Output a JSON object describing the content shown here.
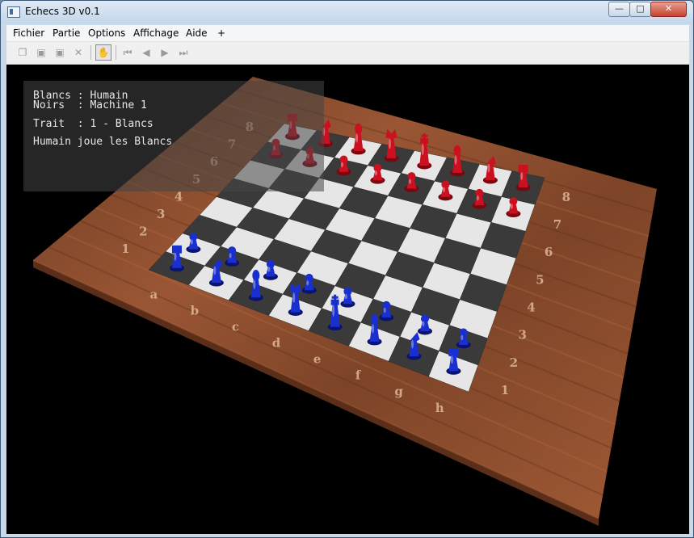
{
  "window": {
    "title": "Echecs 3D v0.1",
    "controls": {
      "minimize": "—",
      "maximize": "□",
      "close": "✕"
    }
  },
  "menu": {
    "items": [
      {
        "label": "Fichier",
        "accel": "F"
      },
      {
        "label": "Partie",
        "accel": "P"
      },
      {
        "label": "Options",
        "accel": "O"
      },
      {
        "label": "Affichage",
        "accel": "A"
      },
      {
        "label": "Aide",
        "accel": "A"
      },
      {
        "label": "+",
        "accel": ""
      }
    ]
  },
  "toolbar": {
    "buttons": [
      {
        "name": "open-icon",
        "glyph": "❐",
        "enabled": false
      },
      {
        "name": "save-icon",
        "glyph": "▣",
        "enabled": false
      },
      {
        "name": "save-as-icon",
        "glyph": "▣",
        "enabled": false
      },
      {
        "name": "close-game-icon",
        "glyph": "✕",
        "enabled": false
      },
      {
        "name": "hand-icon",
        "glyph": "✋",
        "enabled": true
      },
      {
        "name": "first-move-icon",
        "glyph": "⏮",
        "enabled": false
      },
      {
        "name": "previous-move-icon",
        "glyph": "◀",
        "enabled": false
      },
      {
        "name": "next-move-icon",
        "glyph": "▶",
        "enabled": false
      },
      {
        "name": "last-move-icon",
        "glyph": "⏭",
        "enabled": false
      }
    ]
  },
  "info": {
    "white_player": "Blancs : Humain",
    "black_player": "Noirs  : Machine 1",
    "turn": "Trait  : 1 - Blancs",
    "status": "Humain joue les Blancs"
  },
  "board": {
    "files": [
      "a",
      "b",
      "c",
      "d",
      "e",
      "f",
      "g",
      "h"
    ],
    "ranks": [
      "1",
      "2",
      "3",
      "4",
      "5",
      "6",
      "7",
      "8"
    ],
    "colors": {
      "light": "#e6e6e6",
      "dark": "#3a3a3a",
      "wood": "#8a4a2a",
      "blue_piece": "#1a2fd0",
      "red_piece": "#cc1020"
    },
    "pieces": {
      "blue": [
        {
          "sq": "a1",
          "type": "rook"
        },
        {
          "sq": "b1",
          "type": "knight"
        },
        {
          "sq": "c1",
          "type": "bishop"
        },
        {
          "sq": "d1",
          "type": "queen"
        },
        {
          "sq": "e1",
          "type": "king"
        },
        {
          "sq": "f1",
          "type": "bishop"
        },
        {
          "sq": "g1",
          "type": "knight"
        },
        {
          "sq": "h1",
          "type": "rook"
        },
        {
          "sq": "a2",
          "type": "pawn"
        },
        {
          "sq": "b2",
          "type": "pawn"
        },
        {
          "sq": "c2",
          "type": "pawn"
        },
        {
          "sq": "d2",
          "type": "pawn"
        },
        {
          "sq": "e2",
          "type": "pawn"
        },
        {
          "sq": "f2",
          "type": "pawn"
        },
        {
          "sq": "g2",
          "type": "pawn"
        },
        {
          "sq": "h2",
          "type": "pawn"
        }
      ],
      "red": [
        {
          "sq": "a8",
          "type": "rook"
        },
        {
          "sq": "b8",
          "type": "knight"
        },
        {
          "sq": "c8",
          "type": "bishop"
        },
        {
          "sq": "d8",
          "type": "queen"
        },
        {
          "sq": "e8",
          "type": "king"
        },
        {
          "sq": "f8",
          "type": "bishop"
        },
        {
          "sq": "g8",
          "type": "knight"
        },
        {
          "sq": "h8",
          "type": "rook"
        },
        {
          "sq": "a7",
          "type": "pawn"
        },
        {
          "sq": "b7",
          "type": "pawn"
        },
        {
          "sq": "c7",
          "type": "pawn"
        },
        {
          "sq": "d7",
          "type": "pawn"
        },
        {
          "sq": "e7",
          "type": "pawn"
        },
        {
          "sq": "f7",
          "type": "pawn"
        },
        {
          "sq": "g7",
          "type": "pawn"
        },
        {
          "sq": "h7",
          "type": "pawn"
        }
      ]
    }
  }
}
